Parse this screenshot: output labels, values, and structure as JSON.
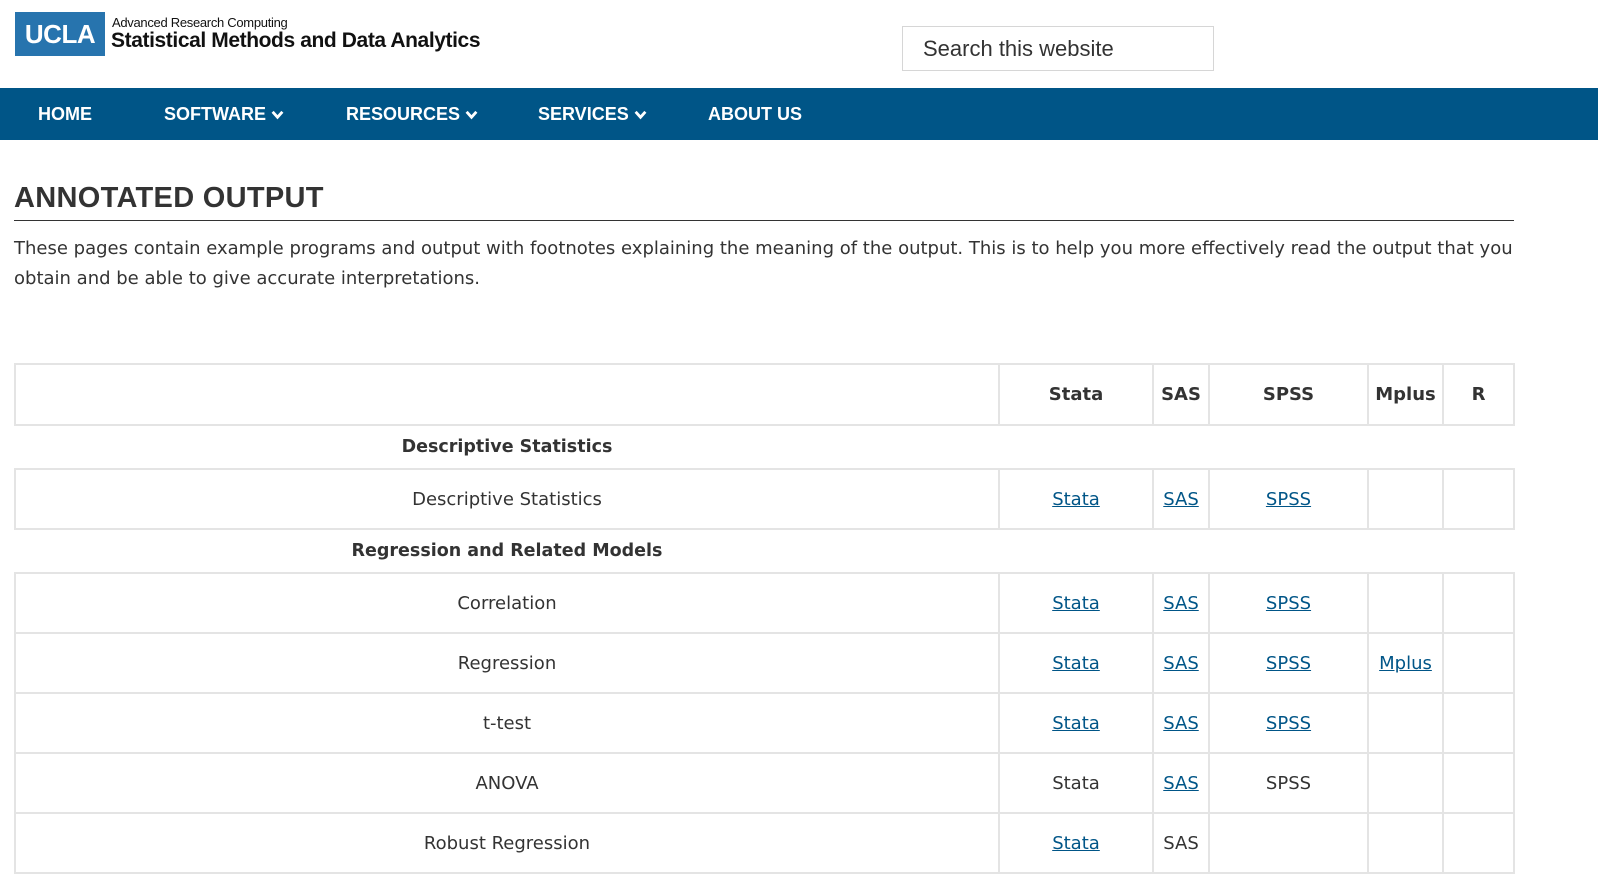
{
  "header": {
    "logo_text": "UCLA",
    "site_super": "Advanced Research Computing",
    "site_title": "Statistical Methods and Data Analytics",
    "search_placeholder": "Search this website"
  },
  "nav": [
    {
      "label": "HOME",
      "dropdown": false
    },
    {
      "label": "SOFTWARE",
      "dropdown": true
    },
    {
      "label": "RESOURCES",
      "dropdown": true
    },
    {
      "label": "SERVICES",
      "dropdown": true
    },
    {
      "label": "ABOUT US",
      "dropdown": false
    }
  ],
  "page": {
    "title": "ANNOTATED OUTPUT",
    "intro": "These pages contain example programs and output with footnotes explaining the meaning of the output. This is to help you more effectively read the output that you obtain and be able to give accurate interpretations."
  },
  "table": {
    "columns": [
      "",
      "Stata",
      "SAS",
      "SPSS",
      "Mplus",
      "R"
    ],
    "sections": [
      {
        "title": "Descriptive Statistics",
        "rows": [
          {
            "label": "Descriptive Statistics",
            "Stata": {
              "text": "Stata",
              "link": true
            },
            "SAS": {
              "text": "SAS",
              "link": true
            },
            "SPSS": {
              "text": "SPSS",
              "link": true
            },
            "Mplus": null,
            "R": null
          }
        ]
      },
      {
        "title": "Regression and Related Models",
        "rows": [
          {
            "label": "Correlation",
            "Stata": {
              "text": "Stata",
              "link": true
            },
            "SAS": {
              "text": "SAS",
              "link": true
            },
            "SPSS": {
              "text": "SPSS",
              "link": true
            },
            "Mplus": null,
            "R": null
          },
          {
            "label": "Regression",
            "Stata": {
              "text": "Stata",
              "link": true
            },
            "SAS": {
              "text": "SAS",
              "link": true
            },
            "SPSS": {
              "text": "SPSS",
              "link": true
            },
            "Mplus": {
              "text": "Mplus",
              "link": true
            },
            "R": null
          },
          {
            "label": "t-test",
            "Stata": {
              "text": "Stata",
              "link": true
            },
            "SAS": {
              "text": "SAS",
              "link": true
            },
            "SPSS": {
              "text": "SPSS",
              "link": true
            },
            "Mplus": null,
            "R": null
          },
          {
            "label": "ANOVA",
            "Stata": {
              "text": "Stata",
              "link": false
            },
            "SAS": {
              "text": "SAS",
              "link": true
            },
            "SPSS": {
              "text": "SPSS",
              "link": false
            },
            "Mplus": null,
            "R": null
          },
          {
            "label": "Robust Regression",
            "Stata": {
              "text": "Stata",
              "link": true
            },
            "SAS": {
              "text": "SAS",
              "link": false
            },
            "SPSS": null,
            "Mplus": null,
            "R": null
          }
        ]
      }
    ]
  },
  "colors": {
    "brand_blue": "#2774ae",
    "nav_blue": "#005587",
    "link": "#005587",
    "border": "#e4e4e4",
    "text": "#333333"
  }
}
